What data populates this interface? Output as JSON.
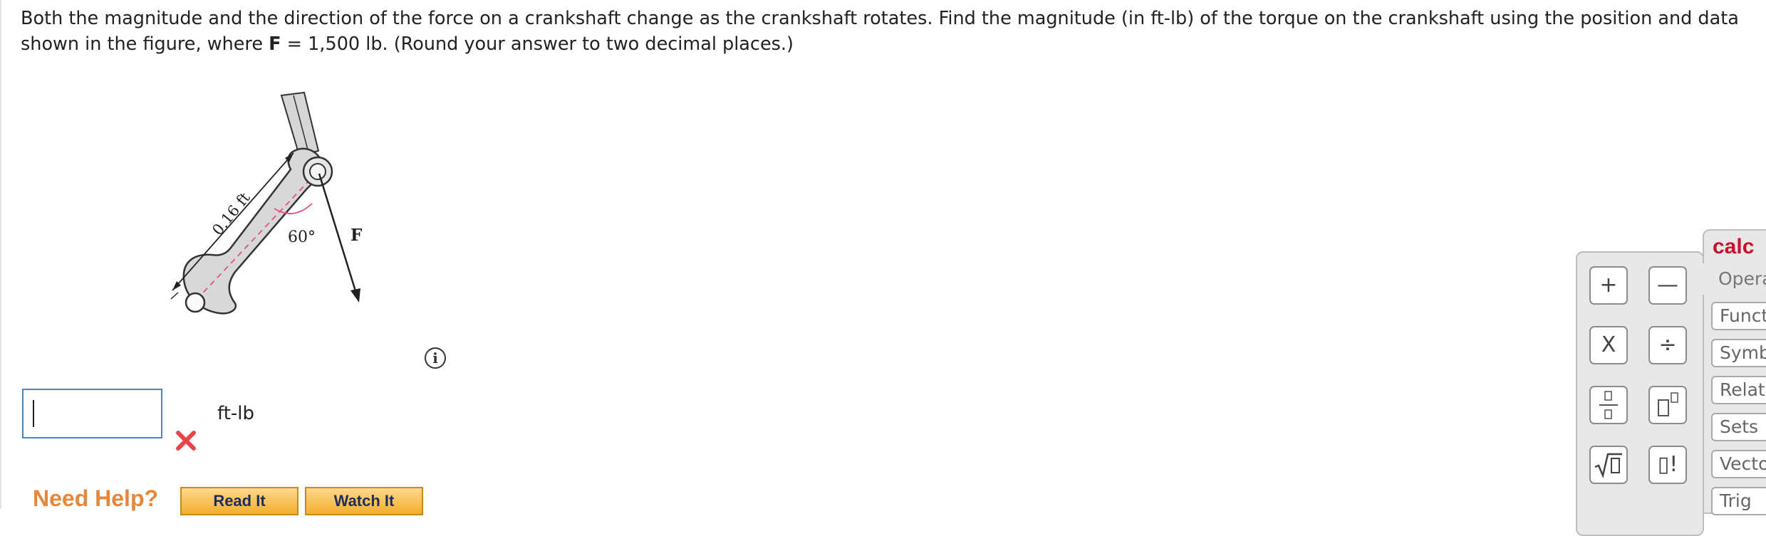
{
  "question": {
    "part1": "Both the magnitude and the direction of the force on a crankshaft change as the crankshaft rotates. Find the magnitude (in ft-lb) of the torque on the crankshaft using the position and data shown in the figure, where ",
    "bold": "F",
    "part2": " = 1,500 lb. (Round your answer to two decimal places.)"
  },
  "figure": {
    "length_label": "0.16 ft",
    "angle_label": "60°",
    "force_label": "F"
  },
  "answer": {
    "value": "",
    "unit": "ft-lb",
    "status": "incorrect"
  },
  "help": {
    "title": "Need Help?",
    "read_label": "Read It",
    "watch_label": "Watch It"
  },
  "calculator": {
    "title": "calc",
    "keys": [
      "+",
      "—",
      "X",
      "÷",
      "fraction",
      "power",
      "sqrt",
      "factorial"
    ],
    "key_plus": "+",
    "key_minus": "—",
    "key_times": "X",
    "key_divide": "÷",
    "key_factorial": "▯!",
    "tabs": [
      "Opera",
      "Funct",
      "Symb",
      "Relati",
      "Sets",
      "Vecto",
      "Trig"
    ]
  },
  "colors": {
    "input_border": "#4a86c5",
    "wrong": "#e8454a",
    "help_orange": "#e8863a",
    "calc_title": "#c8102e"
  }
}
